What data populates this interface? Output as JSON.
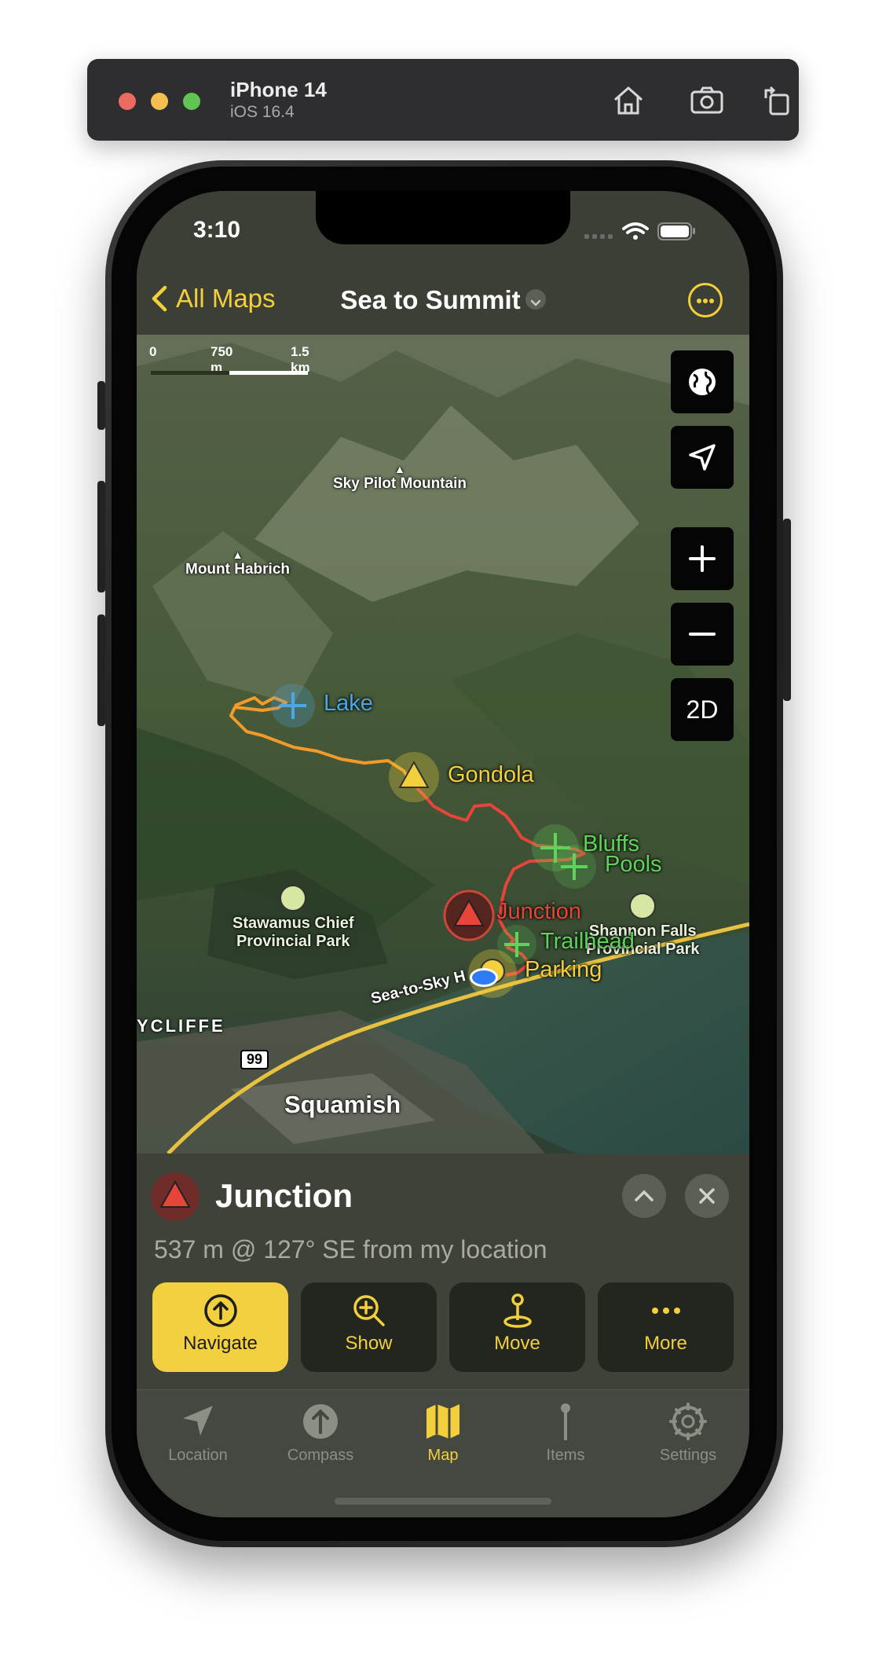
{
  "simulator": {
    "device": "iPhone 14",
    "os": "iOS 16.4",
    "icons": [
      "home-icon",
      "screenshot-icon",
      "rotate-icon"
    ]
  },
  "status_bar": {
    "time": "3:10",
    "icons": [
      "signal-icon",
      "wifi-icon",
      "battery-icon"
    ]
  },
  "nav": {
    "back_label": "All Maps",
    "title": "Sea to Summit",
    "more_icon": "ellipsis-circle-icon"
  },
  "map": {
    "scale": {
      "zero": "0",
      "mid": "750 m",
      "max": "1.5 km"
    },
    "controls": [
      "globe-icon",
      "location-arrow-icon",
      "plus-icon",
      "minus-icon"
    ],
    "mode_label": "2D",
    "place_labels": {
      "sky_pilot": "Sky Pilot Mountain",
      "habrich": "Mount Habrich",
      "stawamus_1": "Stawamus Chief",
      "stawamus_2": "Provincial Park",
      "shannon_1": "Shannon Falls",
      "shannon_2": "Provincial Park",
      "ycliffe": "YCLIFFE",
      "squamish": "Squamish",
      "highway_num": "99",
      "road": "Sea-to-Sky H"
    },
    "waypoints": {
      "lake": "Lake",
      "gondola": "Gondola",
      "bluffs": "Bluffs",
      "pools": "Pools",
      "junction": "Junction",
      "trailhead": "Trailhead",
      "parking": "Parking"
    },
    "colors": {
      "trail_orange": "#f39a2a",
      "trail_red": "#e8443a",
      "waypoint_green": "#5fd35a",
      "waypoint_blue": "#4aa8e8",
      "accent": "#f3cf3c"
    }
  },
  "panel": {
    "title": "Junction",
    "subtitle": "537 m @ 127° SE from my location",
    "buttons": {
      "navigate": "Navigate",
      "show": "Show",
      "move": "Move",
      "more": "More"
    }
  },
  "tabs": {
    "location": "Location",
    "compass": "Compass",
    "map": "Map",
    "items": "Items",
    "settings": "Settings",
    "active": "Map"
  }
}
